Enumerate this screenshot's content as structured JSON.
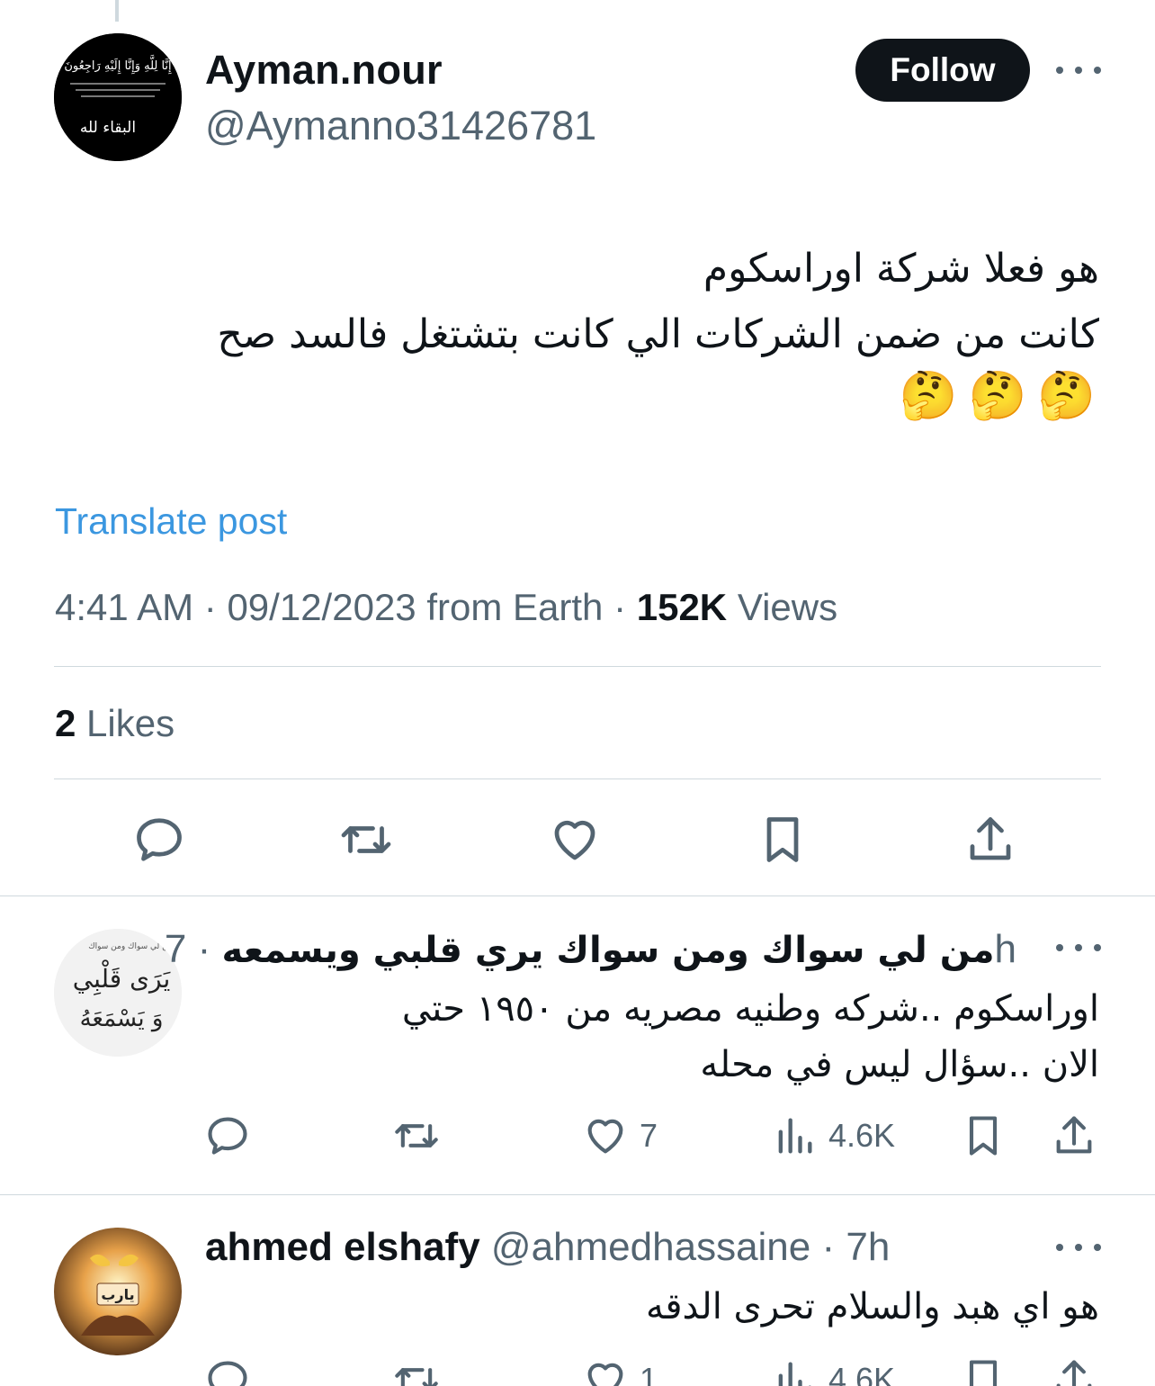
{
  "post": {
    "author_name": "Ayman.nour",
    "author_handle": "@Aymanno31426781",
    "avatar_text": {
      "line1": "إِنَّا لِلَّهِ وَإِنَّا إِلَيْهِ رَاجِعُونَ",
      "line2": "البقاء لله"
    },
    "follow_label": "Follow",
    "text_line1": "هو فعلا شركة اوراسكوم",
    "text_line2": "كانت من ضمن الشركات الي كانت بتشتغل فالسد صح",
    "emojis": [
      "🤔",
      "🤔",
      "🤔"
    ],
    "translate_label": "Translate post",
    "time": "4:41 AM",
    "date": "09/12/2023 from Earth",
    "views_count": "152K",
    "views_label": "Views",
    "likes_count": "2",
    "likes_label": "Likes"
  },
  "replies": [
    {
      "name": "من لي سواك ومن سواك يري قلبي ويسمعه",
      "time": "7h",
      "avatar_text": {
        "small": "من لي سواك ومن سواك",
        "line1": "يَرَى قَلْبِي",
        "line2": "وَ يَسْمَعَهُ"
      },
      "text_line1": "اوراسكوم ..شركه وطنيه مصريه من ١٩٥٠  حتي",
      "text_line2": "الان ..سؤال ليس في محله",
      "likes": "7",
      "views": "4.6K"
    },
    {
      "name": "ahmed elshafy",
      "handle": "@ahmedhassaine",
      "time": "7h",
      "avatar_text": {
        "badge": "يارب"
      },
      "text_line1": "هو اي هبد والسلام تحرى الدقه",
      "likes": "1",
      "views": "4.6K"
    }
  ],
  "separator": "·",
  "icons": {
    "reply": "reply-icon",
    "repost": "repost-icon",
    "like": "heart-icon",
    "bookmark": "bookmark-icon",
    "share": "share-icon",
    "views": "analytics-icon",
    "more": "more-icon"
  },
  "colors": {
    "text": "#0f1419",
    "secondary": "#536471",
    "link": "#3b97e0",
    "divider": "#cfd9de",
    "follow_bg": "#0f1419"
  }
}
